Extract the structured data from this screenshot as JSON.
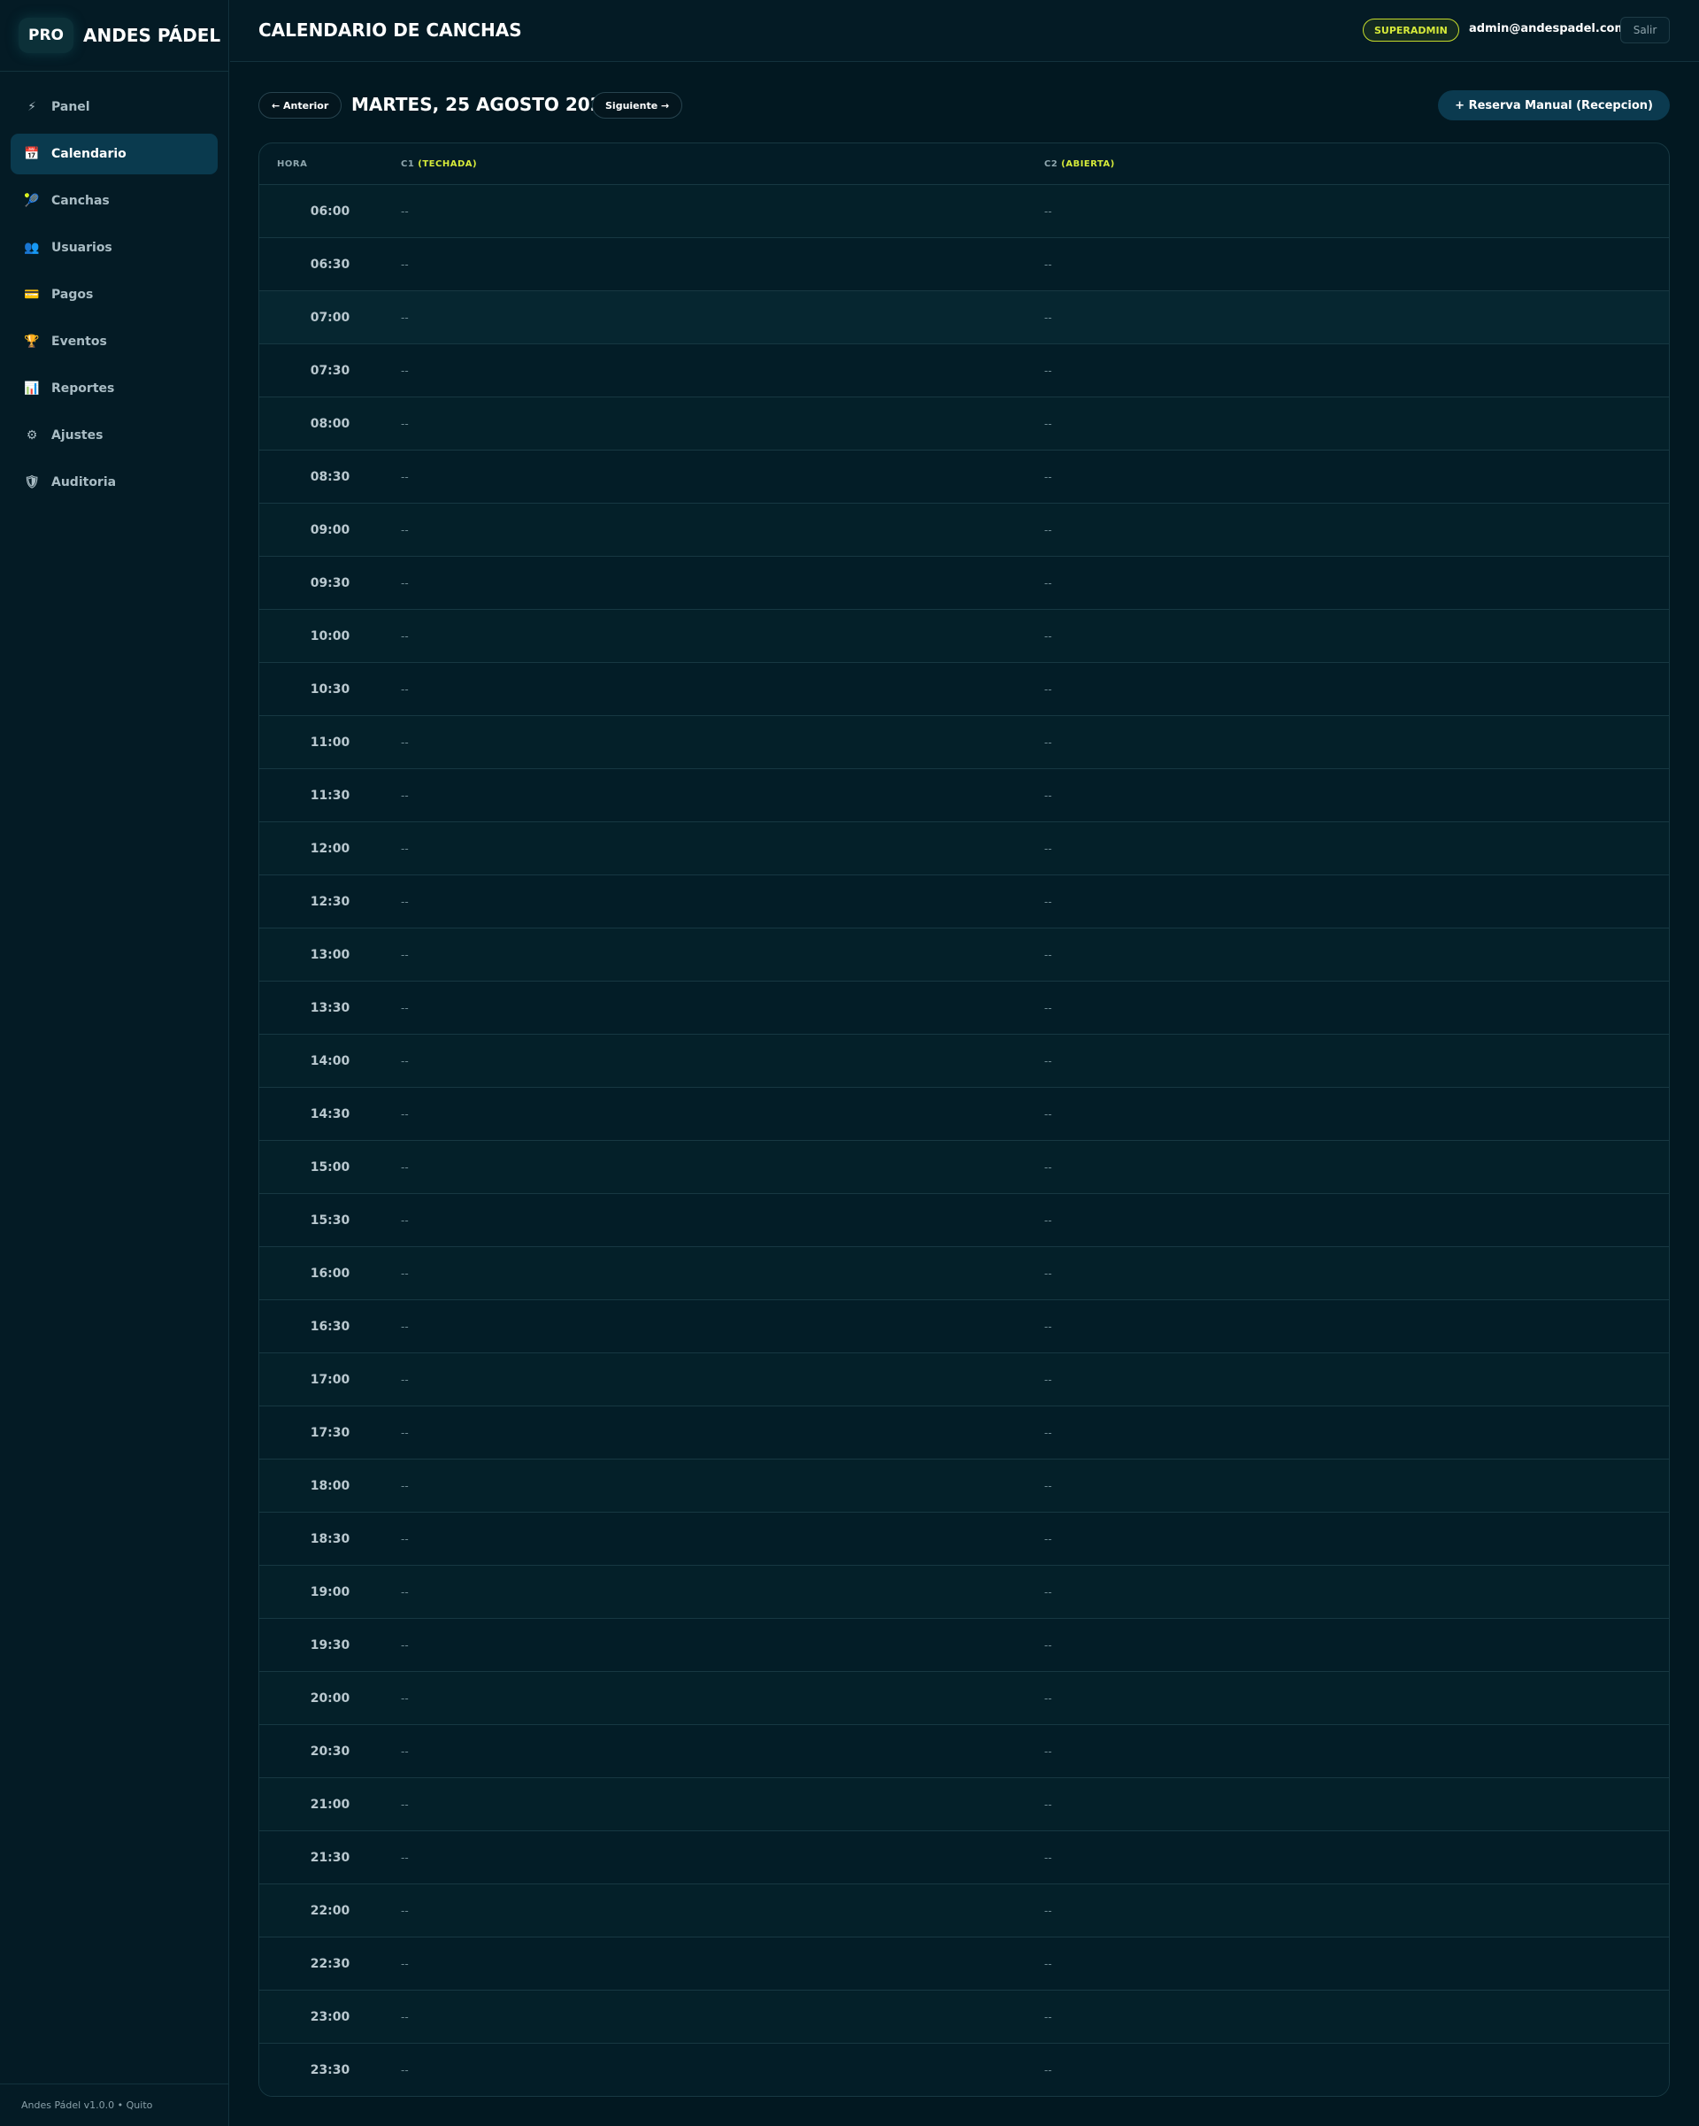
{
  "brand": {
    "badge": "PRO",
    "name": "ANDES PÁDEL"
  },
  "sidebar": {
    "items": [
      {
        "label": "Panel",
        "icon": "⚡",
        "icon_name": "bolt-icon",
        "active": false
      },
      {
        "label": "Calendario",
        "icon": "📅",
        "icon_name": "calendar-icon",
        "active": true
      },
      {
        "label": "Canchas",
        "icon": "🎾",
        "icon_name": "ball-icon",
        "active": false
      },
      {
        "label": "Usuarios",
        "icon": "👥",
        "icon_name": "users-icon",
        "active": false
      },
      {
        "label": "Pagos",
        "icon": "💳",
        "icon_name": "credit-card-icon",
        "active": false
      },
      {
        "label": "Eventos",
        "icon": "🏆",
        "icon_name": "trophy-icon",
        "active": false
      },
      {
        "label": "Reportes",
        "icon": "📊",
        "icon_name": "bar-chart-icon",
        "active": false
      },
      {
        "label": "Ajustes",
        "icon": "⚙",
        "icon_name": "gear-icon",
        "active": false
      },
      {
        "label": "Auditoria",
        "icon": "🛡",
        "icon_name": "shield-icon",
        "active": false
      }
    ],
    "footer": "Andes Pádel v1.0.0 • Quito"
  },
  "header": {
    "title": "CALENDARIO DE CANCHAS",
    "role": "SUPERADMIN",
    "email": "admin@andespadel.com",
    "logout": "Salir"
  },
  "date_nav": {
    "prev": "← Anterior",
    "date": "MARTES, 25 AGOSTO 2026",
    "next": "Siguiente →",
    "manual_booking": "+ Reserva Manual (Recepcion)"
  },
  "calendar": {
    "columns": {
      "hour": "HORA",
      "c1_name": "C1",
      "c1_type": "(TECHADA)",
      "c2_name": "C2",
      "c2_type": "(ABIERTA)"
    },
    "empty_slot": "--",
    "rows": [
      {
        "time": "06:00",
        "c1": "--",
        "c2": "--"
      },
      {
        "time": "06:30",
        "c1": "--",
        "c2": "--"
      },
      {
        "time": "07:00",
        "c1": "--",
        "c2": "--"
      },
      {
        "time": "07:30",
        "c1": "--",
        "c2": "--"
      },
      {
        "time": "08:00",
        "c1": "--",
        "c2": "--"
      },
      {
        "time": "08:30",
        "c1": "--",
        "c2": "--"
      },
      {
        "time": "09:00",
        "c1": "--",
        "c2": "--"
      },
      {
        "time": "09:30",
        "c1": "--",
        "c2": "--"
      },
      {
        "time": "10:00",
        "c1": "--",
        "c2": "--"
      },
      {
        "time": "10:30",
        "c1": "--",
        "c2": "--"
      },
      {
        "time": "11:00",
        "c1": "--",
        "c2": "--"
      },
      {
        "time": "11:30",
        "c1": "--",
        "c2": "--"
      },
      {
        "time": "12:00",
        "c1": "--",
        "c2": "--"
      },
      {
        "time": "12:30",
        "c1": "--",
        "c2": "--"
      },
      {
        "time": "13:00",
        "c1": "--",
        "c2": "--"
      },
      {
        "time": "13:30",
        "c1": "--",
        "c2": "--"
      },
      {
        "time": "14:00",
        "c1": "--",
        "c2": "--"
      },
      {
        "time": "14:30",
        "c1": "--",
        "c2": "--"
      },
      {
        "time": "15:00",
        "c1": "--",
        "c2": "--"
      },
      {
        "time": "15:30",
        "c1": "--",
        "c2": "--"
      },
      {
        "time": "16:00",
        "c1": "--",
        "c2": "--"
      },
      {
        "time": "16:30",
        "c1": "--",
        "c2": "--"
      },
      {
        "time": "17:00",
        "c1": "--",
        "c2": "--"
      },
      {
        "time": "17:30",
        "c1": "--",
        "c2": "--"
      },
      {
        "time": "18:00",
        "c1": "--",
        "c2": "--"
      },
      {
        "time": "18:30",
        "c1": "--",
        "c2": "--"
      },
      {
        "time": "19:00",
        "c1": "--",
        "c2": "--"
      },
      {
        "time": "19:30",
        "c1": "--",
        "c2": "--"
      },
      {
        "time": "20:00",
        "c1": "--",
        "c2": "--"
      },
      {
        "time": "20:30",
        "c1": "--",
        "c2": "--"
      },
      {
        "time": "21:00",
        "c1": "--",
        "c2": "--"
      },
      {
        "time": "21:30",
        "c1": "--",
        "c2": "--"
      },
      {
        "time": "22:00",
        "c1": "--",
        "c2": "--"
      },
      {
        "time": "22:30",
        "c1": "--",
        "c2": "--"
      },
      {
        "time": "23:00",
        "c1": "--",
        "c2": "--"
      },
      {
        "time": "23:30",
        "c1": "--",
        "c2": "--"
      }
    ]
  },
  "colors": {
    "accent": "#d6ea3a",
    "active_nav": "#0a3a4e",
    "background": "#021821"
  }
}
